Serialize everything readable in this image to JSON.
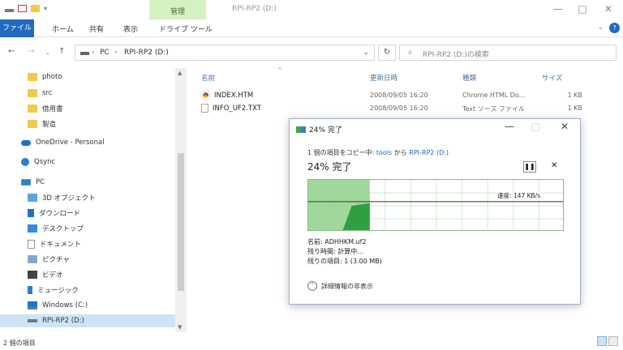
{
  "window": {
    "context_tab": "管理",
    "title": "RPI-RP2 (D:)"
  },
  "ribbon": {
    "tabs": [
      "ファイル",
      "ホーム",
      "共有",
      "表示",
      "ドライブ ツール"
    ]
  },
  "address": {
    "crumbs": [
      "PC",
      "RPI-RP2 (D:)"
    ],
    "search_placeholder": "RPI-RP2 (D:)の検索"
  },
  "sidebar": {
    "items": [
      {
        "label": "photo",
        "icon": "folder-icon"
      },
      {
        "label": "src",
        "icon": "folder-icon"
      },
      {
        "label": "借用書",
        "icon": "folder-icon"
      },
      {
        "label": "製造",
        "icon": "folder-icon"
      },
      {
        "label": "OneDrive - Personal",
        "icon": "onedrive-icon"
      },
      {
        "label": "Qsync",
        "icon": "qsync-icon"
      },
      {
        "label": "PC",
        "icon": "pc-icon"
      },
      {
        "label": "3D オブジェクト",
        "icon": "3d-objects-icon"
      },
      {
        "label": "ダウンロード",
        "icon": "download-icon"
      },
      {
        "label": "デスクトップ",
        "icon": "desktop-icon"
      },
      {
        "label": "ドキュメント",
        "icon": "document-icon"
      },
      {
        "label": "ピクチャ",
        "icon": "pictures-icon"
      },
      {
        "label": "ビデオ",
        "icon": "video-icon"
      },
      {
        "label": "ミュージック",
        "icon": "music-icon"
      },
      {
        "label": "Windows (C:)",
        "icon": "windows-drive-icon"
      },
      {
        "label": "RPI-RP2 (D:)",
        "icon": "drive-icon"
      }
    ]
  },
  "columns": {
    "name": "名前",
    "date": "更新日時",
    "type": "種類",
    "size": "サイズ"
  },
  "files": [
    {
      "name": "INDEX.HTM",
      "date": "2008/09/05 16:20",
      "type": "Chrome HTML Do...",
      "size": "1 KB",
      "icon": "chrome-icon"
    },
    {
      "name": "INFO_UF2.TXT",
      "date": "2008/09/05 16:20",
      "type": "Text ソース ファイル",
      "size": "1 KB",
      "icon": "text-file-icon"
    }
  ],
  "status": {
    "count": "2 個の項目"
  },
  "dialog": {
    "title": "24% 完了",
    "line_prefix": "1 個の項目をコピー中: ",
    "source": "tools",
    "line_mid": " から ",
    "dest": "RPI-RP2 (D:)",
    "percent_text": "24% 完了",
    "progress": 0.24,
    "speed": "速度: 147 KB/s",
    "name_line": "名前: ADHHKM.uf2",
    "time_line": "残り時間: 計算中...",
    "items_line": "残りの項目: 1 (3.00 MB)",
    "more_details": "詳細情報の非表示",
    "colors": {
      "graph_fill": "#8fd18a",
      "graph_dark": "#2ea043",
      "accent": "#1a66c2"
    }
  }
}
